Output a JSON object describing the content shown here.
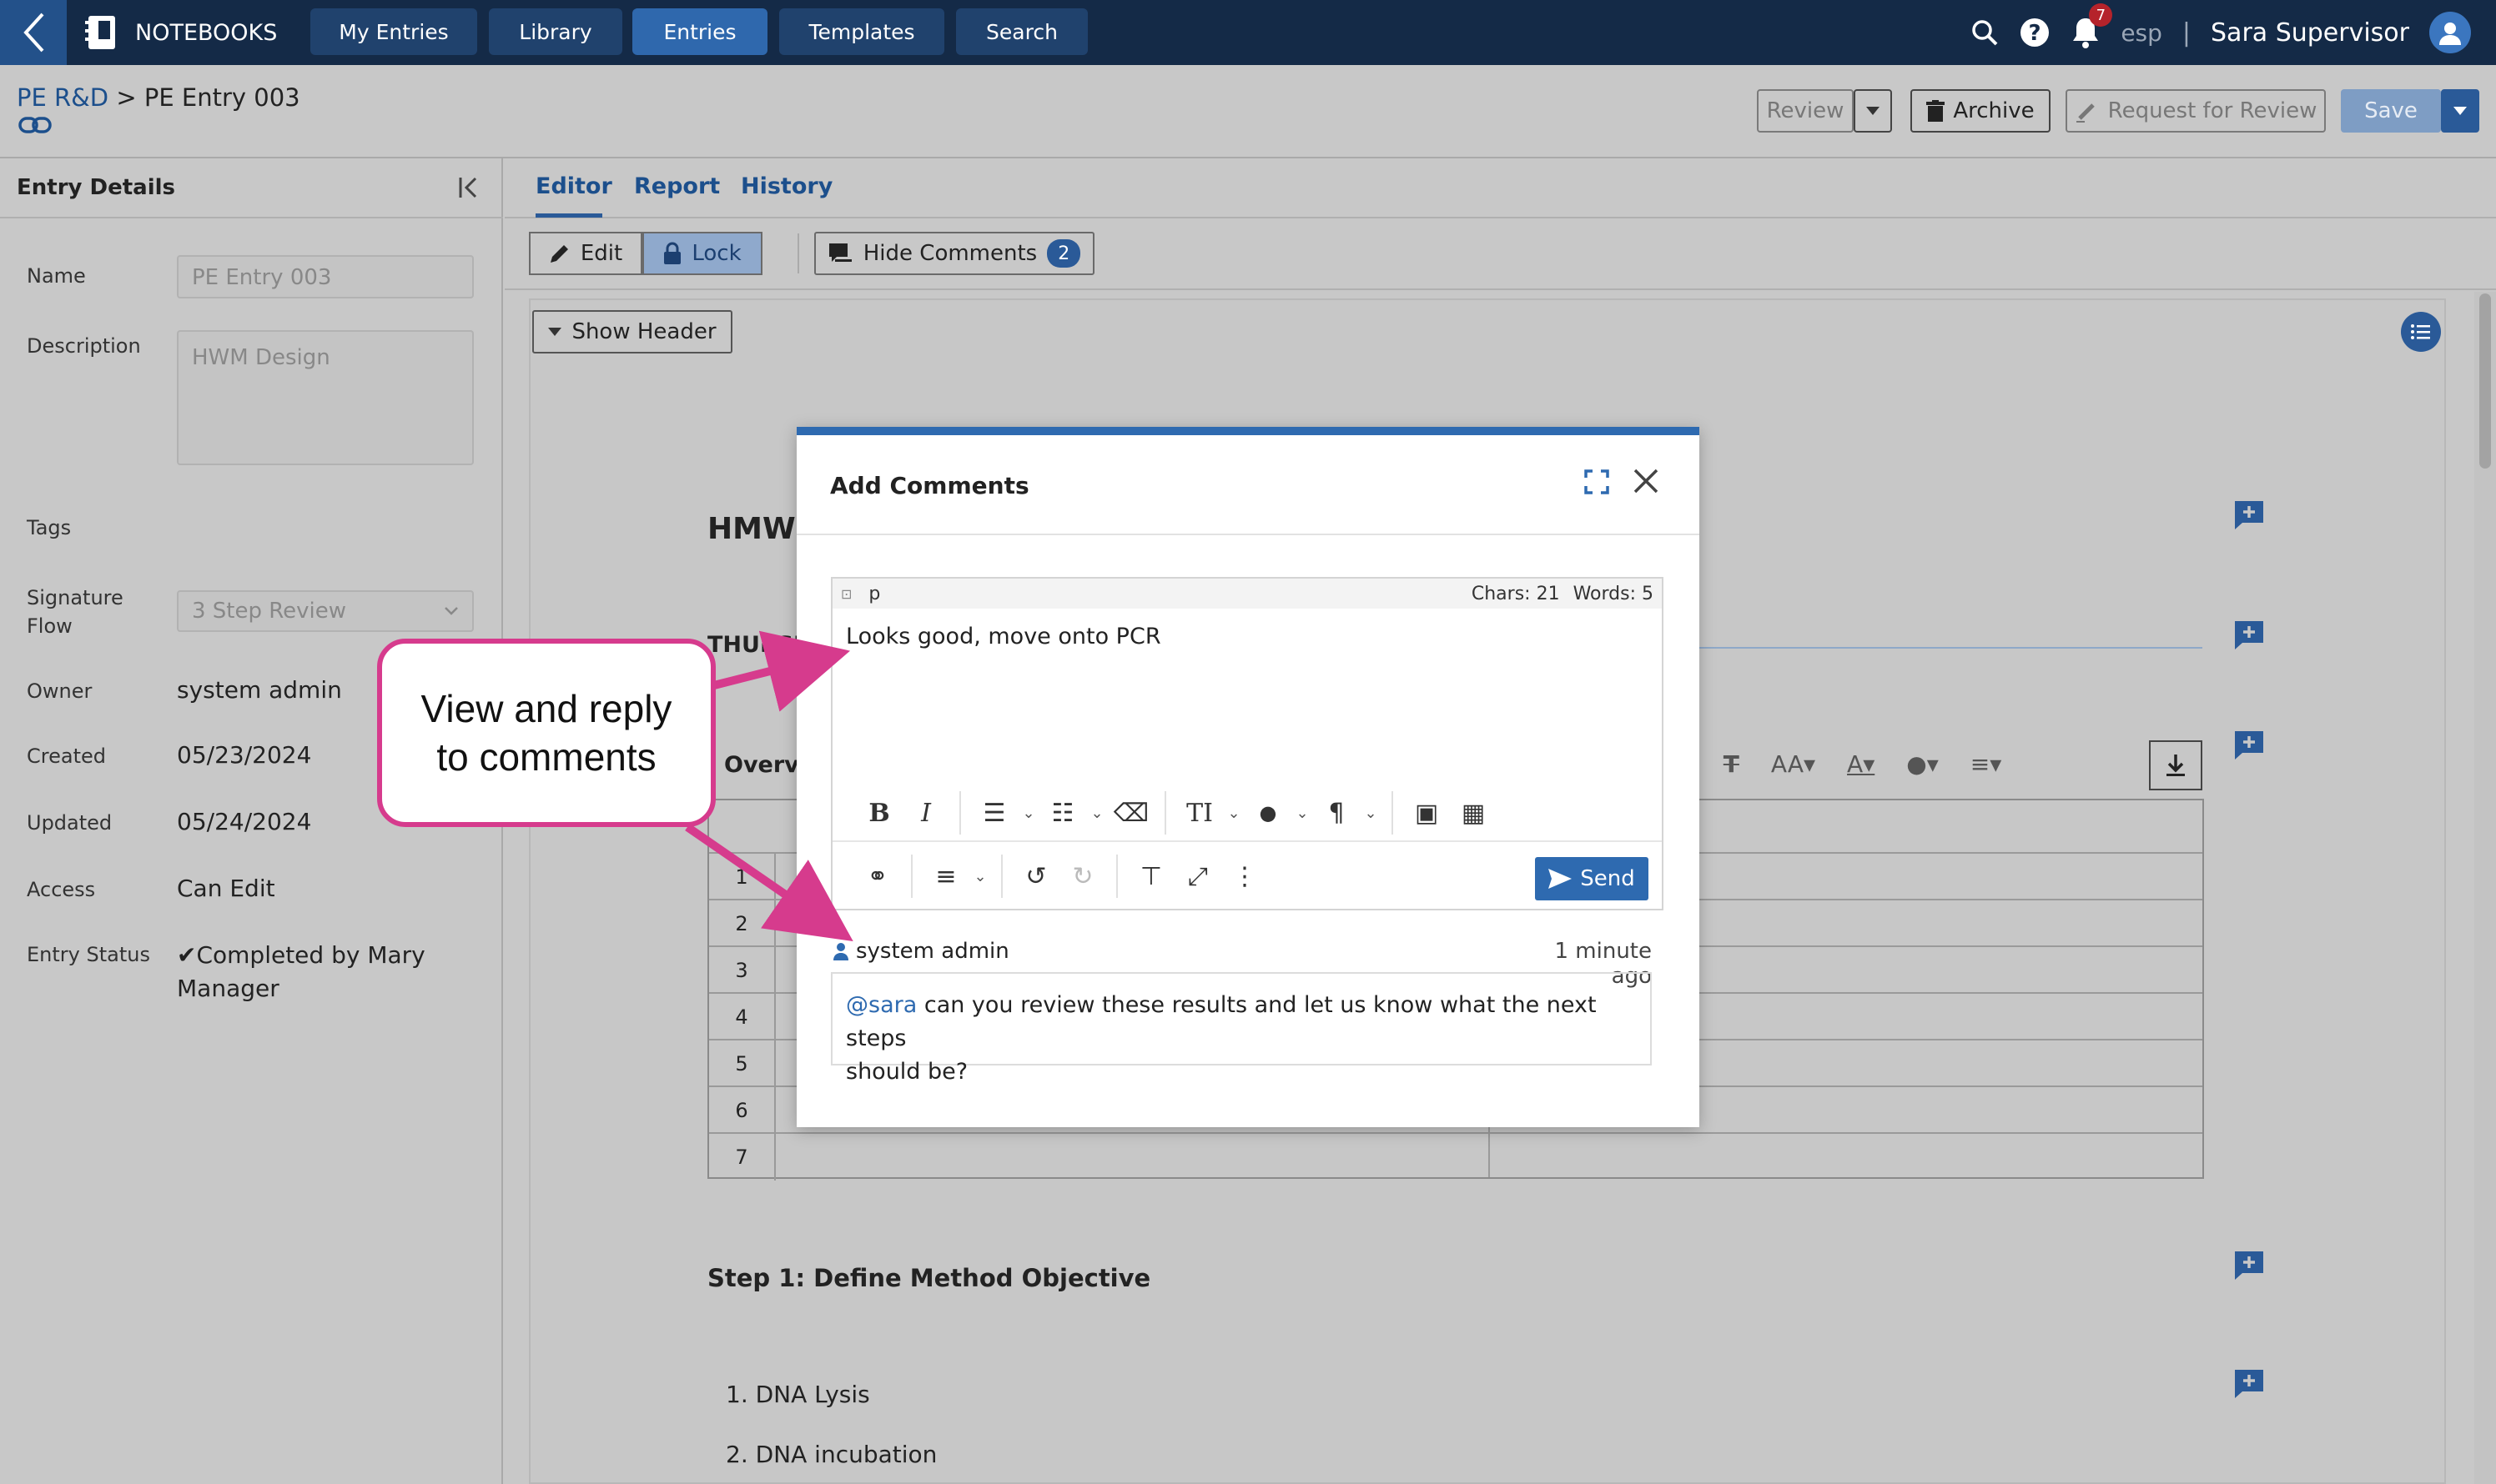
{
  "topnav": {
    "brand": "NOTEBOOKS",
    "tabs": [
      {
        "label": "My Entries"
      },
      {
        "label": "Library"
      },
      {
        "label": "Entries"
      },
      {
        "label": "Templates"
      },
      {
        "label": "Search"
      }
    ],
    "active_tab": "Entries",
    "notification_count": "7",
    "language": "esp",
    "user_name": "Sara Supervisor"
  },
  "breadcrumb": {
    "parent": "PE R&D",
    "separator": ">",
    "current": "PE Entry 003"
  },
  "actions": {
    "review": "Review",
    "archive": "Archive",
    "request_review": "Request for Review",
    "save": "Save"
  },
  "details": {
    "header": "Entry Details",
    "name_label": "Name",
    "name_value": "PE Entry 003",
    "description_label": "Description",
    "description_value": "HWM Design",
    "tags_label": "Tags",
    "signature_label_1": "Signature",
    "signature_label_2": "Flow",
    "signature_value": "3 Step Review",
    "owner_label": "Owner",
    "owner_value": "system admin",
    "created_label": "Created",
    "created_value": "05/23/2024",
    "updated_label": "Updated",
    "updated_value": "05/24/2024",
    "access_label": "Access",
    "access_value": "Can Edit",
    "status_label": "Entry Status",
    "status_value_1": "✔Completed by Mary",
    "status_value_2": "Manager"
  },
  "main_tabs": [
    "Editor",
    "Report",
    "History"
  ],
  "editor_bar": {
    "edit": "Edit",
    "lock": "Lock",
    "hide_comments": "Hide Comments",
    "comment_count": "2"
  },
  "document": {
    "show_header": "Show Header",
    "title_fragment": "HMW",
    "date_fragment": "THURSD",
    "overview_fragment": "Overvie",
    "row_numbers": [
      "1",
      "2",
      "3",
      "4",
      "5",
      "6",
      "7"
    ],
    "step1": "Step 1: Define Method Objective",
    "list_items": [
      "1.  DNA Lysis",
      "2.  DNA incubation"
    ]
  },
  "modal": {
    "title": "Add Comments",
    "status_tag": "p",
    "chars": "Chars: 21",
    "words": "Words: 5",
    "draft_text": "Looks good, move onto PCR",
    "send": "Send",
    "comment": {
      "author": "system admin",
      "time": "1 minute ago",
      "mention": "@sara",
      "text_1": " can you review these results and let us know what the next steps",
      "text_2": "should be?"
    }
  },
  "callout": {
    "line1": "View and reply",
    "line2": "to comments",
    "color": "#d63b8d"
  },
  "colors": {
    "nav_bg": "#142a47",
    "accent": "#2e6ab0",
    "badge": "#b5232b"
  }
}
